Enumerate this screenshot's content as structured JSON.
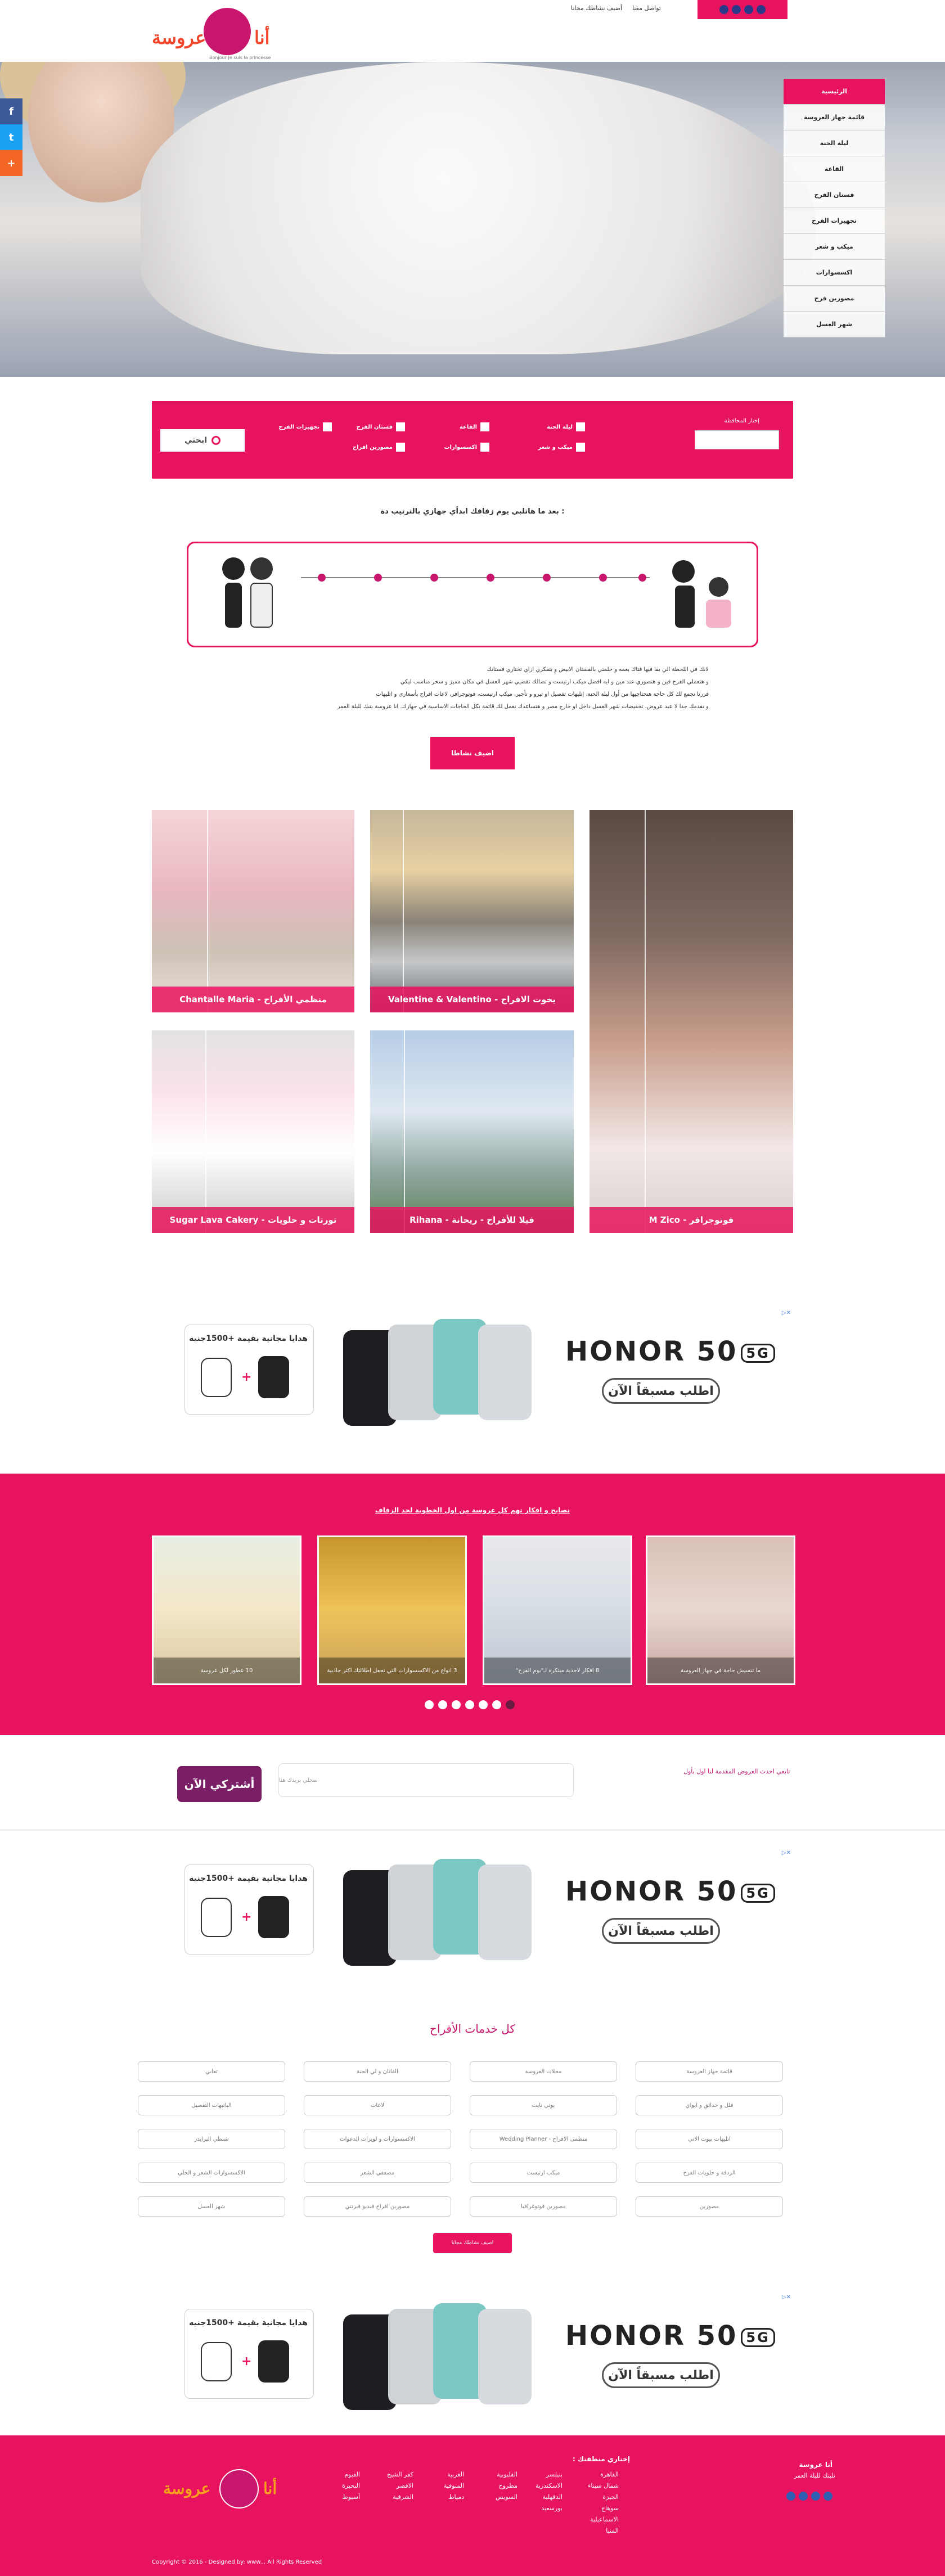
{
  "header": {
    "logo_ar": "أنا عروسة",
    "logo_tagline": "Bonjour Je suis la princesse",
    "top_links": [
      "أضيف نشاطك مجانا",
      "تواصل معنا"
    ],
    "social_icons": [
      "twitter-icon",
      "facebook-icon",
      "instagram-icon",
      "pinterest-icon"
    ]
  },
  "menu": {
    "items": [
      "الرئيسية",
      "قائمة جهاز العروسة",
      "ليلة الحنة",
      "القاعة",
      "فستان الفرح",
      "تجهيزات الفرح",
      "ميكب و شعر",
      "اكسسوارات",
      "مصورين فرح",
      "شهر العسل"
    ]
  },
  "side_share": [
    "f",
    "t",
    "+"
  ],
  "search": {
    "label": "إختار المحافظة",
    "select_value": "",
    "options": [
      "ليلة الحنة",
      "القاعة",
      "فستان الفرح",
      "تجهيزات الفرح",
      "ميكب و شعر",
      "اكسسوارات",
      "مصورين افراح"
    ],
    "button": "ابحثي"
  },
  "timeline": {
    "title": "بعد ما هاتلبي يوم زفافك ابدأي جهازي بالترتيب دة :"
  },
  "intro": {
    "lines": [
      "لانك في اللحظة الي بقا فيها فتاك بعمه و حلمتي بالفستان الابيض و بتفكري ازاي تختاري فستانك",
      "و هتعملي الفرح فين و هتصوري عند مين و ايه افضل ميكب ارتيست و تصالك تقضيي شهر العسل في مكان مميز و سحر مناسب ليكي",
      "قررنا نجمع لك كل حاجة هتحتاجيها من أول ليلة الحنة، إتليهات تفصيل او تيرو و تأجير، ميكب ارتيست، فوتوجرافر، لاعات افراح بأسعارى و اتليهات",
      "و نقدمك جدا لا عبد عروض، تخفيضات شهر العسل داخل او خارج مصر و هتساعدك نعمل لك قائمة بكل الحاجات الاساسية في جهازك. انا عروسة بتبك لليلة العمر"
    ],
    "button": "اضيف نشاطا"
  },
  "gallery": [
    {
      "caption": "Chantalle Maria - منظمي الأفراح"
    },
    {
      "caption": "Valentine & Valentino - يخوت الافراح"
    },
    {
      "caption": "M Zico - فوتوجرافر"
    },
    {
      "caption": "Sugar Lava Cakery - تورتات و حلويات"
    },
    {
      "caption": "Rihana - فيلا للأفراح - ريحانة"
    }
  ],
  "ads": {
    "gift_text": "هدايا مجانية بقيمة +1500جنيه",
    "brand": "HONOR 50",
    "badge": "5G",
    "cta": "اطلب مسبقاً الآن"
  },
  "tips": {
    "title": "نصايح و افكار تهم كل عروسة من اول الخطوبة لحد الزفاف",
    "cards": [
      "10 عطور لكل عروسة",
      "3 انواع من الاكسسوارات التي تجعل اطلالتك اكثر جاذبية",
      "8 افكار لاحذية مبتكرة لـ\"يوم الفرح\"",
      "ما تنسيش حاجة في جهاز العروسة"
    ],
    "dots": 7,
    "active_dot": 6
  },
  "newsletter": {
    "label": "تابعي احدث العروض المقدمة لنا اول بأول",
    "placeholder": "سجلي بريدك هنا",
    "button": "أشتركي الآن"
  },
  "services": {
    "title": "كل خدمات الأفراح",
    "rows": [
      [
        "قائمة جهاز العروسة",
        "محلات العروسة",
        "الفاتان و لي الحنة",
        "تعابي"
      ],
      [
        "فلل و حدائق و ايواي",
        "يوتي نايت",
        "لاعات",
        "الباتيهات التفصيل"
      ],
      [
        "اتليهات بيوت الاتي",
        "منظمى الافراح - Wedding Planner",
        "الاكسسوارات و لويزات الدعوات",
        "شنطي البرايدز"
      ],
      [
        "الزدفة و حلويات الفرح",
        "ميكب ارتيست",
        "مصففي الشعر",
        "الاكسسوارات الشعر و الحلي"
      ],
      [
        "مصورين",
        "مصورين فوتوغرافيا",
        "مصورين افراح فيديو فيرتني",
        "شهر العسل"
      ]
    ],
    "add_button": "اضيف نشاطك مجانا"
  },
  "footer": {
    "brand_title": "أنا عروسة",
    "brand_sub": "نليتك لليلة العمر",
    "areas_title": "إختاري منطقتك :",
    "col1": [
      "القاهرة",
      "شمال سيناء",
      "الجيزة",
      "سوهاج",
      "الاسماعيلية",
      "المنيا"
    ],
    "col2": [
      "بنيلسر",
      "الاسكندرية",
      "الدقهلية",
      "بورسعيد"
    ],
    "col3": [
      "القليوبية",
      "مطروح",
      "السويس"
    ],
    "col4": [
      "الغربية",
      "المنوفية",
      "دمياط"
    ],
    "col5": [
      "كفر الشيخ",
      "الاقصر",
      "الشرقية"
    ],
    "col6": [
      "الفيوم",
      "البحيرة",
      "أسيوط"
    ],
    "copyright": "Copyright © 2016 - Designed by: www... All Rights Reserved"
  }
}
